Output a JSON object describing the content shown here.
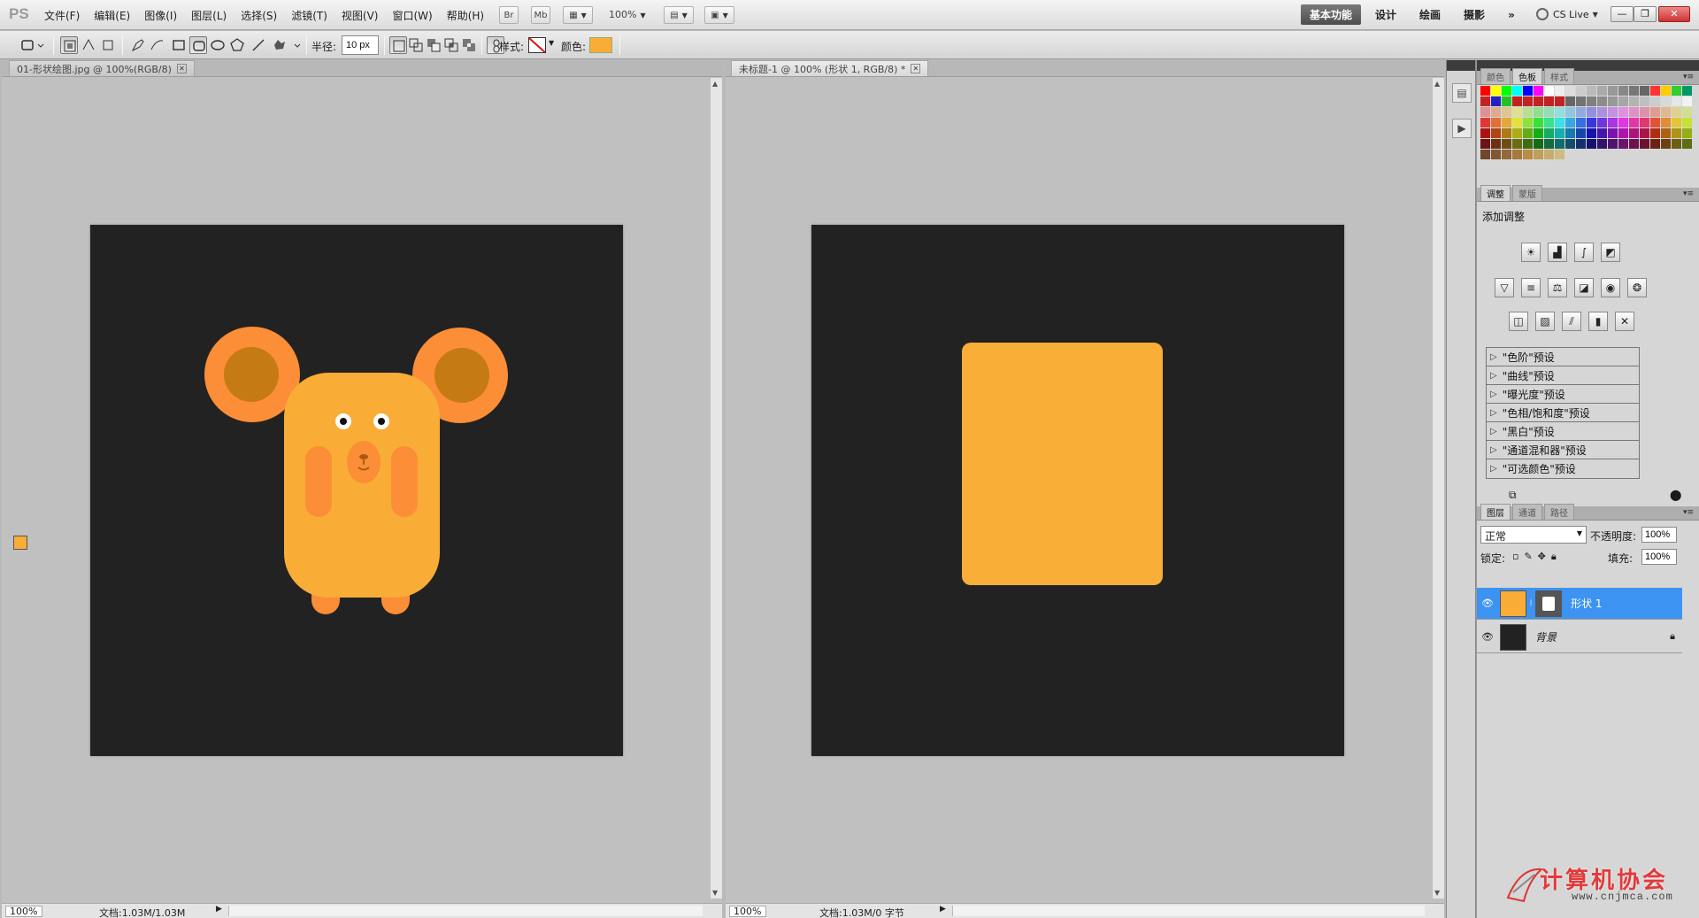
{
  "app": {
    "logo": "PS",
    "menu": [
      "文件(F)",
      "编辑(E)",
      "图像(I)",
      "图层(L)",
      "选择(S)",
      "滤镜(T)",
      "视图(V)",
      "窗口(W)",
      "帮助(H)"
    ],
    "bridge_btn": "Br",
    "minibridge_btn": "Mb",
    "zoom": "100%",
    "workspaces": [
      "基本功能",
      "设计",
      "绘画",
      "摄影"
    ],
    "more_workspaces": "»",
    "cslive": "CS Live"
  },
  "options": {
    "radius_label": "半径:",
    "radius_value": "10 px",
    "style_label": "样式:",
    "color_label": "颜色:",
    "color": "#f9ac36"
  },
  "documents": [
    {
      "tab": "01-形状绘图.jpg @ 100%(RGB/8)",
      "status_zoom": "100%",
      "status_info": "文档:1.03M/1.03M"
    },
    {
      "tab": "未标题-1 @ 100% (形状 1, RGB/8) *",
      "status_zoom": "100%",
      "status_info": "文档:1.03M/0 字节"
    }
  ],
  "colors": {
    "canvas_bg": "#222222",
    "bear_body": "#f9ac36",
    "bear_ear_outer": "#fb8e36",
    "bear_ear_inner": "#c67a14",
    "bear_limb": "#fb8e36",
    "shape_fill": "#f9ae38",
    "layer_selected": "#3d93f2"
  },
  "panels": {
    "swatch_tabs": [
      "颜色",
      "色板",
      "样式"
    ],
    "adjust_tabs": [
      "调整",
      "蒙版"
    ],
    "adjust_title": "添加调整",
    "presets": [
      "\"色阶\"预设",
      "\"曲线\"预设",
      "\"曝光度\"预设",
      "\"色相/饱和度\"预设",
      "\"黑白\"预设",
      "\"通道混和器\"预设",
      "\"可选颜色\"预设"
    ],
    "layer_tabs": [
      "图层",
      "通道",
      "路径"
    ],
    "blend_mode": "正常",
    "opacity_label": "不透明度:",
    "opacity": "100%",
    "lock_label": "锁定:",
    "fill_label": "填充:",
    "fill": "100%",
    "layers": [
      {
        "name": "形状 1",
        "selected": true
      },
      {
        "name": "背景",
        "selected": false
      }
    ]
  },
  "watermark": {
    "cn": "计算机协会",
    "en": "www.cnjmca.com"
  }
}
